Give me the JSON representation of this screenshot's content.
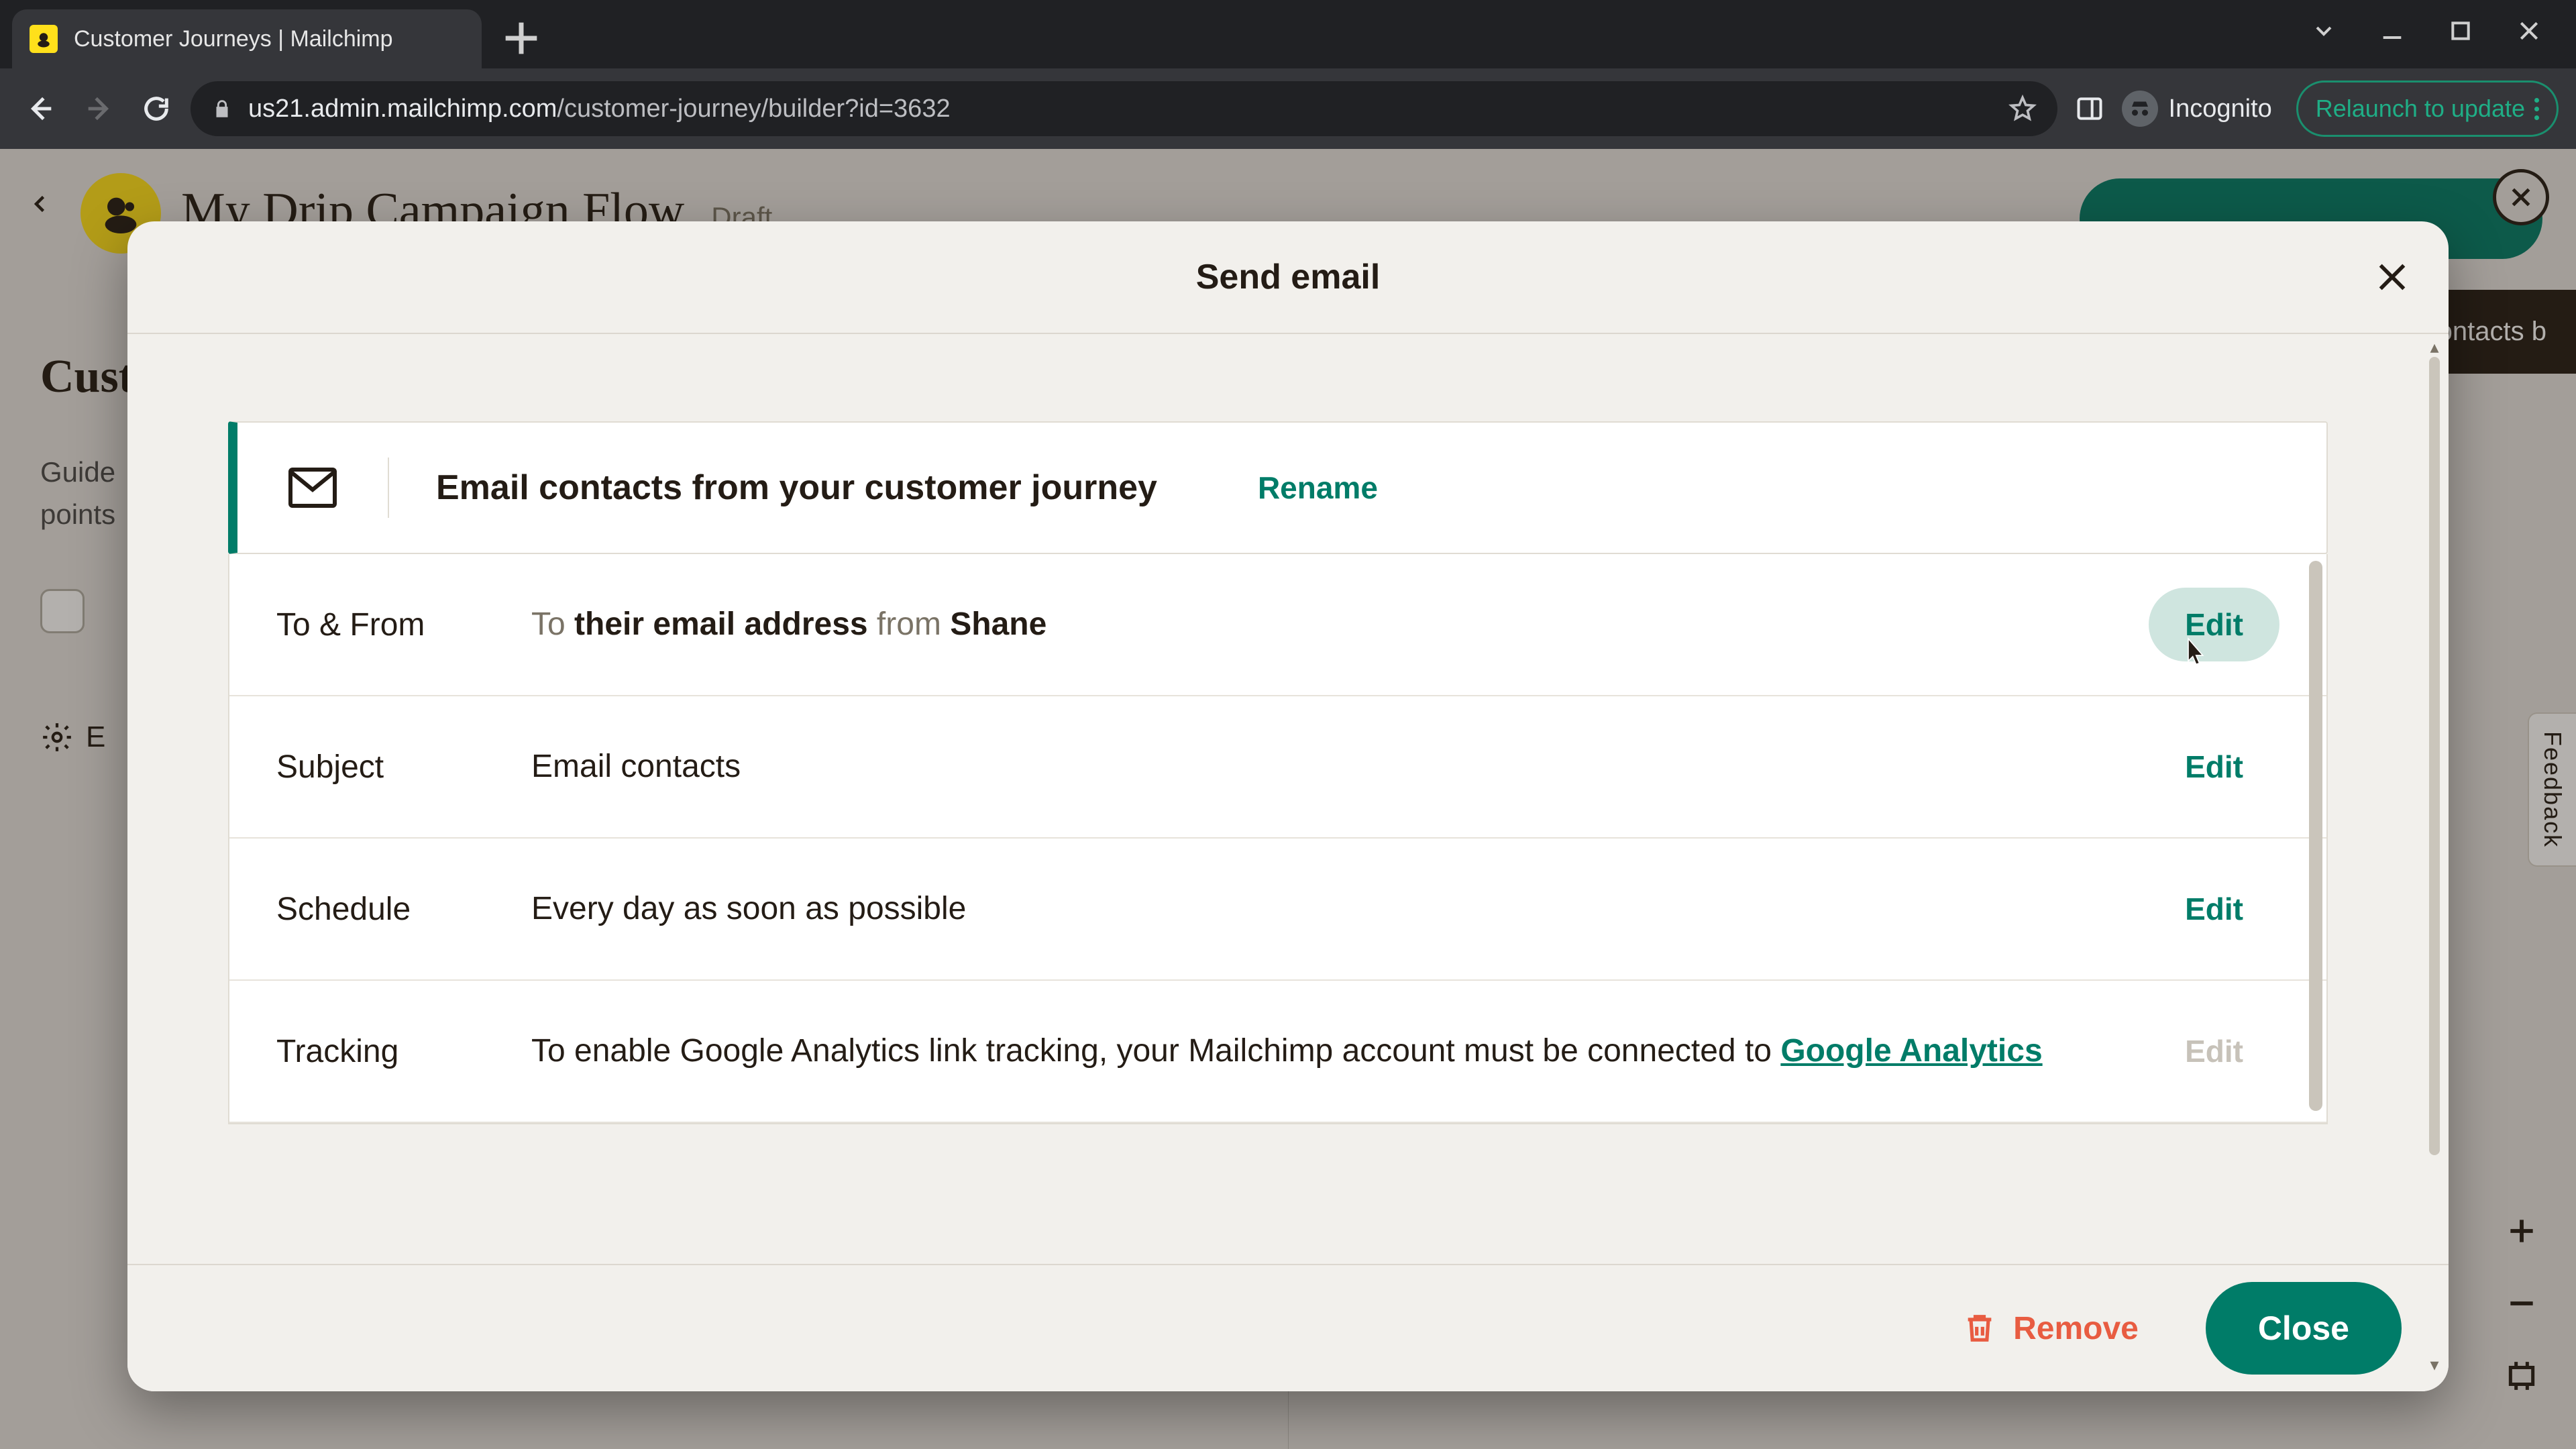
{
  "browser": {
    "tab_title": "Customer Journeys | Mailchimp",
    "url_domain": "us21.admin.mailchimp.com",
    "url_path": "/customer-journey/builder?id=3632",
    "incognito_label": "Incognito",
    "relaunch_label": "Relaunch to update"
  },
  "builder": {
    "title": "My Drip Campaign Flow",
    "status": "Draft",
    "sidebar_heading_partial": "Cust",
    "sidebar_desc_line1": "Guide",
    "sidebar_desc_line2": "points",
    "sidebar_settings_partial": "E",
    "right_tooltip_partial": "ontacts b",
    "feedback_label": "Feedback"
  },
  "modal": {
    "title": "Send email",
    "card_title": "Email contacts from your customer journey",
    "rename_label": "Rename",
    "rows": {
      "to_from": {
        "label": "To & From",
        "to_word": "To",
        "to_value": "their email address",
        "from_word": "from",
        "from_value": "Shane",
        "edit": "Edit"
      },
      "subject": {
        "label": "Subject",
        "value": "Email contacts",
        "edit": "Edit"
      },
      "schedule": {
        "label": "Schedule",
        "value": "Every day as soon as possible",
        "edit": "Edit"
      },
      "tracking": {
        "label": "Tracking",
        "text": "To enable Google Analytics link tracking, your Mailchimp account must be connected to ",
        "link": "Google Analytics",
        "edit": "Edit"
      }
    },
    "remove_label": "Remove",
    "close_label": "Close"
  }
}
